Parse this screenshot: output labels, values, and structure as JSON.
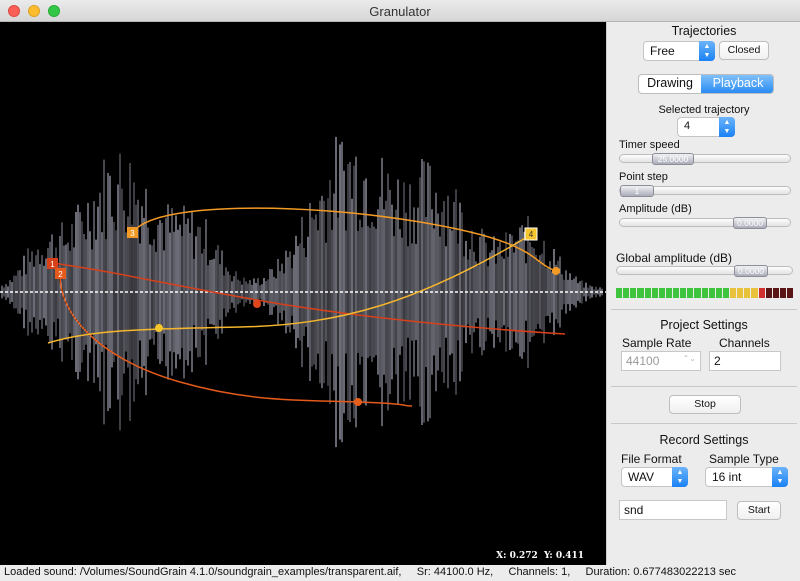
{
  "window": {
    "title": "Granulator"
  },
  "canvas": {
    "coords": {
      "x_label": "X:",
      "x_value": "0.272",
      "y_label": "Y:",
      "y_value": "0.411"
    },
    "trajectories": [
      {
        "label": "1",
        "color": "#d8401a"
      },
      {
        "label": "2",
        "color": "#e35a1a"
      },
      {
        "label": "3",
        "color": "#f29a25"
      },
      {
        "label": "4",
        "color": "#f5b52d"
      }
    ]
  },
  "panel": {
    "trajectories": {
      "title": "Trajectories",
      "type_value": "Free",
      "closed_button": "Closed",
      "mode_drawing": "Drawing",
      "mode_playback": "Playback",
      "selected_label": "Selected trajectory",
      "selected_value": "4"
    },
    "timer_speed": {
      "label": "Timer speed",
      "value": "25.0000",
      "level": 0.25
    },
    "point_step": {
      "label": "Point step",
      "value": "1",
      "level": 0.0
    },
    "amplitude": {
      "label": "Amplitude (dB)",
      "value": "0.0000",
      "level": 0.83
    },
    "global_amplitude": {
      "label": "Global amplitude (dB)",
      "value": "0.0000",
      "level": 0.83,
      "meter": {
        "green": 16,
        "yellow": 4,
        "red": 5,
        "lit_to": 21
      }
    },
    "project": {
      "title": "Project Settings",
      "sample_rate_label": "Sample Rate",
      "sample_rate_value": "44100",
      "channels_label": "Channels",
      "channels_value": "2",
      "stop_button": "Stop"
    },
    "record": {
      "title": "Record Settings",
      "file_format_label": "File Format",
      "file_format_value": "WAV",
      "sample_type_label": "Sample Type",
      "sample_type_value": "16 int",
      "filename_value": "snd",
      "start_button": "Start"
    }
  },
  "status": {
    "loaded": "Loaded sound: /Volumes/SoundGrain 4.1.0/soundgrain_examples/transparent.aif,",
    "sr": "Sr: 44100.0 Hz,",
    "channels": "Channels: 1,",
    "duration": "Duration: 0.677483022213 sec"
  },
  "colors": {
    "accent": "#2a8cf4",
    "waveform": "#dcdcf2"
  }
}
